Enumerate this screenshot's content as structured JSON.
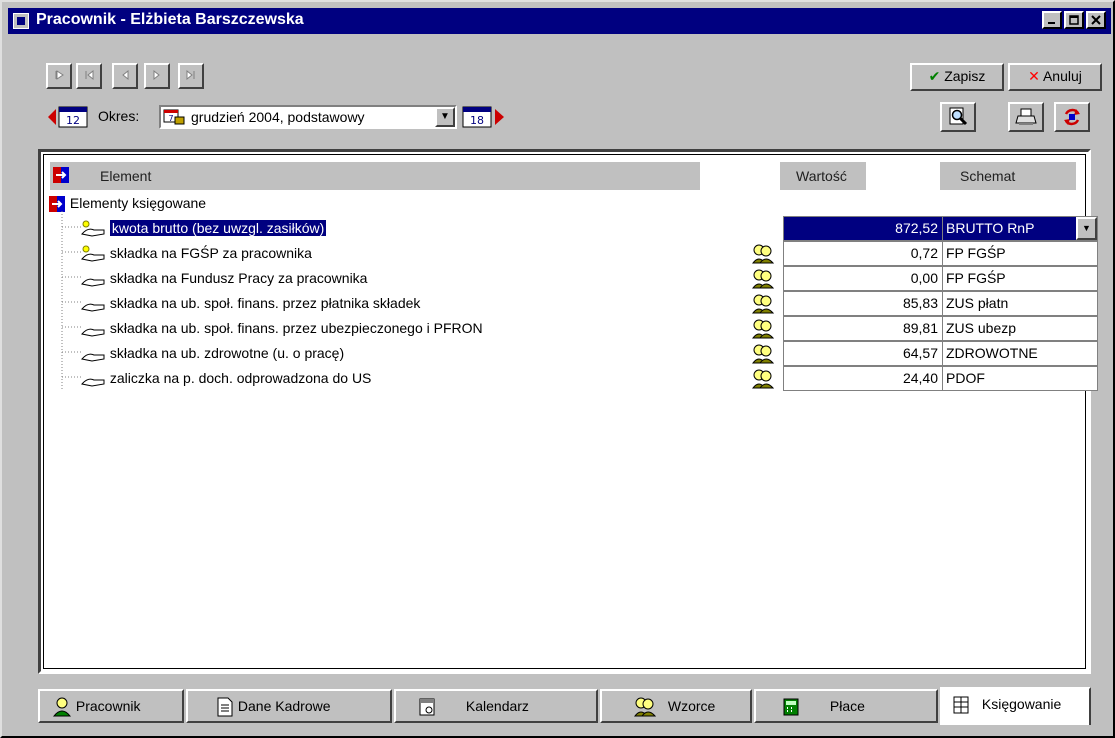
{
  "window": {
    "title": "Pracownik - Elżbieta Barszczewska"
  },
  "toolbar": {
    "save_label": "Zapisz",
    "cancel_label": "Anuluj",
    "period_label": "Okres:",
    "period_value": "grudzień 2004, podstawowy",
    "prev_period_icon": "12",
    "next_period_icon": "18"
  },
  "table": {
    "headers": {
      "element": "Element",
      "value": "Wartość",
      "schema": "Schemat"
    },
    "group_label": "Elementy księgowane",
    "rows": [
      {
        "label": "kwota brutto (bez uwzgl. zasiłków)",
        "value": "872,52",
        "schema": "BRUTTO RnP",
        "selected": true,
        "has_people_icon": false
      },
      {
        "label": "składka na FGŚP za pracownika",
        "value": "0,72",
        "schema": "FP FGŚP",
        "has_people_icon": true
      },
      {
        "label": "składka na Fundusz Pracy za pracownika",
        "value": "0,00",
        "schema": "FP FGŚP",
        "has_people_icon": true
      },
      {
        "label": "składka na ub. społ. finans. przez płatnika składek",
        "value": "85,83",
        "schema": "ZUS płatn",
        "has_people_icon": true
      },
      {
        "label": "składka na ub. społ. finans. przez ubezpieczonego i PFRON",
        "value": "89,81",
        "schema": "ZUS ubezp",
        "has_people_icon": true
      },
      {
        "label": "składka na ub. zdrowotne (u. o pracę)",
        "value": "64,57",
        "schema": "ZDROWOTNE",
        "has_people_icon": true
      },
      {
        "label": "zaliczka na p. doch. odprowadzona do US",
        "value": "24,40",
        "schema": "PDOF",
        "has_people_icon": true
      }
    ]
  },
  "tabs": [
    {
      "label": "Pracownik",
      "icon": "person-icon"
    },
    {
      "label": "Dane Kadrowe",
      "icon": "document-icon"
    },
    {
      "label": "Kalendarz",
      "icon": "calendar-icon"
    },
    {
      "label": "Wzorce",
      "icon": "people-icon"
    },
    {
      "label": "Płace",
      "icon": "calculator-icon"
    },
    {
      "label": "Księgowanie",
      "icon": "ledger-icon",
      "active": true
    }
  ],
  "colors": {
    "titlebar": "#000080",
    "face": "#c0c0c0",
    "selection": "#000080",
    "save_check": "#008000",
    "cancel_x": "#ff0000",
    "element_icon_red": "#cc0000",
    "element_icon_blue": "#0000cc"
  }
}
